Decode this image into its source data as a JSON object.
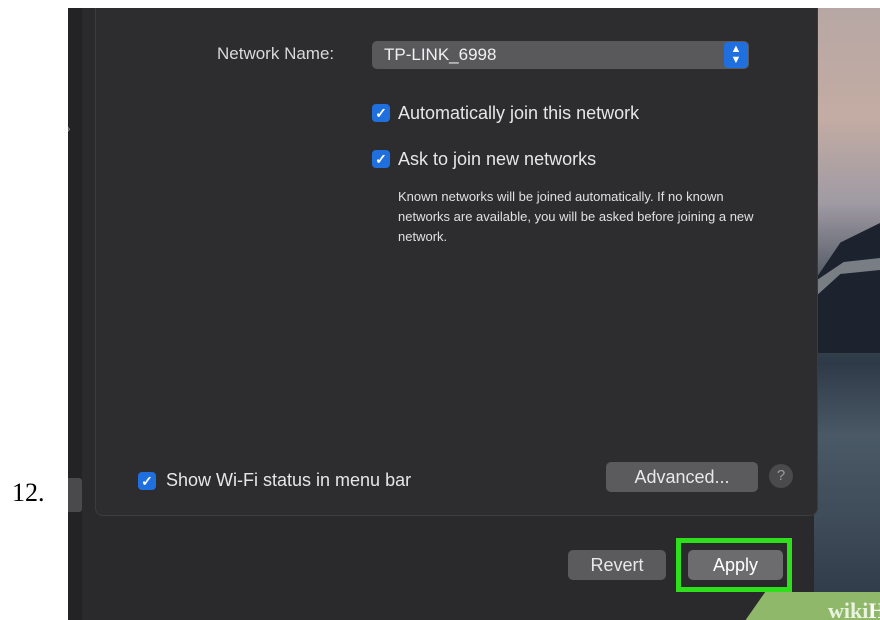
{
  "step": {
    "number": "12."
  },
  "network": {
    "label": "Network Name:",
    "selected": "TP-LINK_6998",
    "stepper_glyph": "⌃⌄"
  },
  "checkboxes": {
    "auto_join": {
      "label": "Automatically join this network",
      "checked": true
    },
    "ask_join": {
      "label": "Ask to join new networks",
      "checked": true
    },
    "ask_join_help": "Known networks will be joined automatically. If no known networks are available, you will be asked before joining a new network.",
    "show_status": {
      "label": "Show Wi-Fi status in menu bar",
      "checked": true
    }
  },
  "buttons": {
    "advanced": "Advanced...",
    "help": "?",
    "revert": "Revert",
    "apply": "Apply"
  },
  "highlight_color": "#2ee01b",
  "accent_color": "#1f6fde",
  "watermark": {
    "wiki": "wiki",
    "how": "How"
  }
}
